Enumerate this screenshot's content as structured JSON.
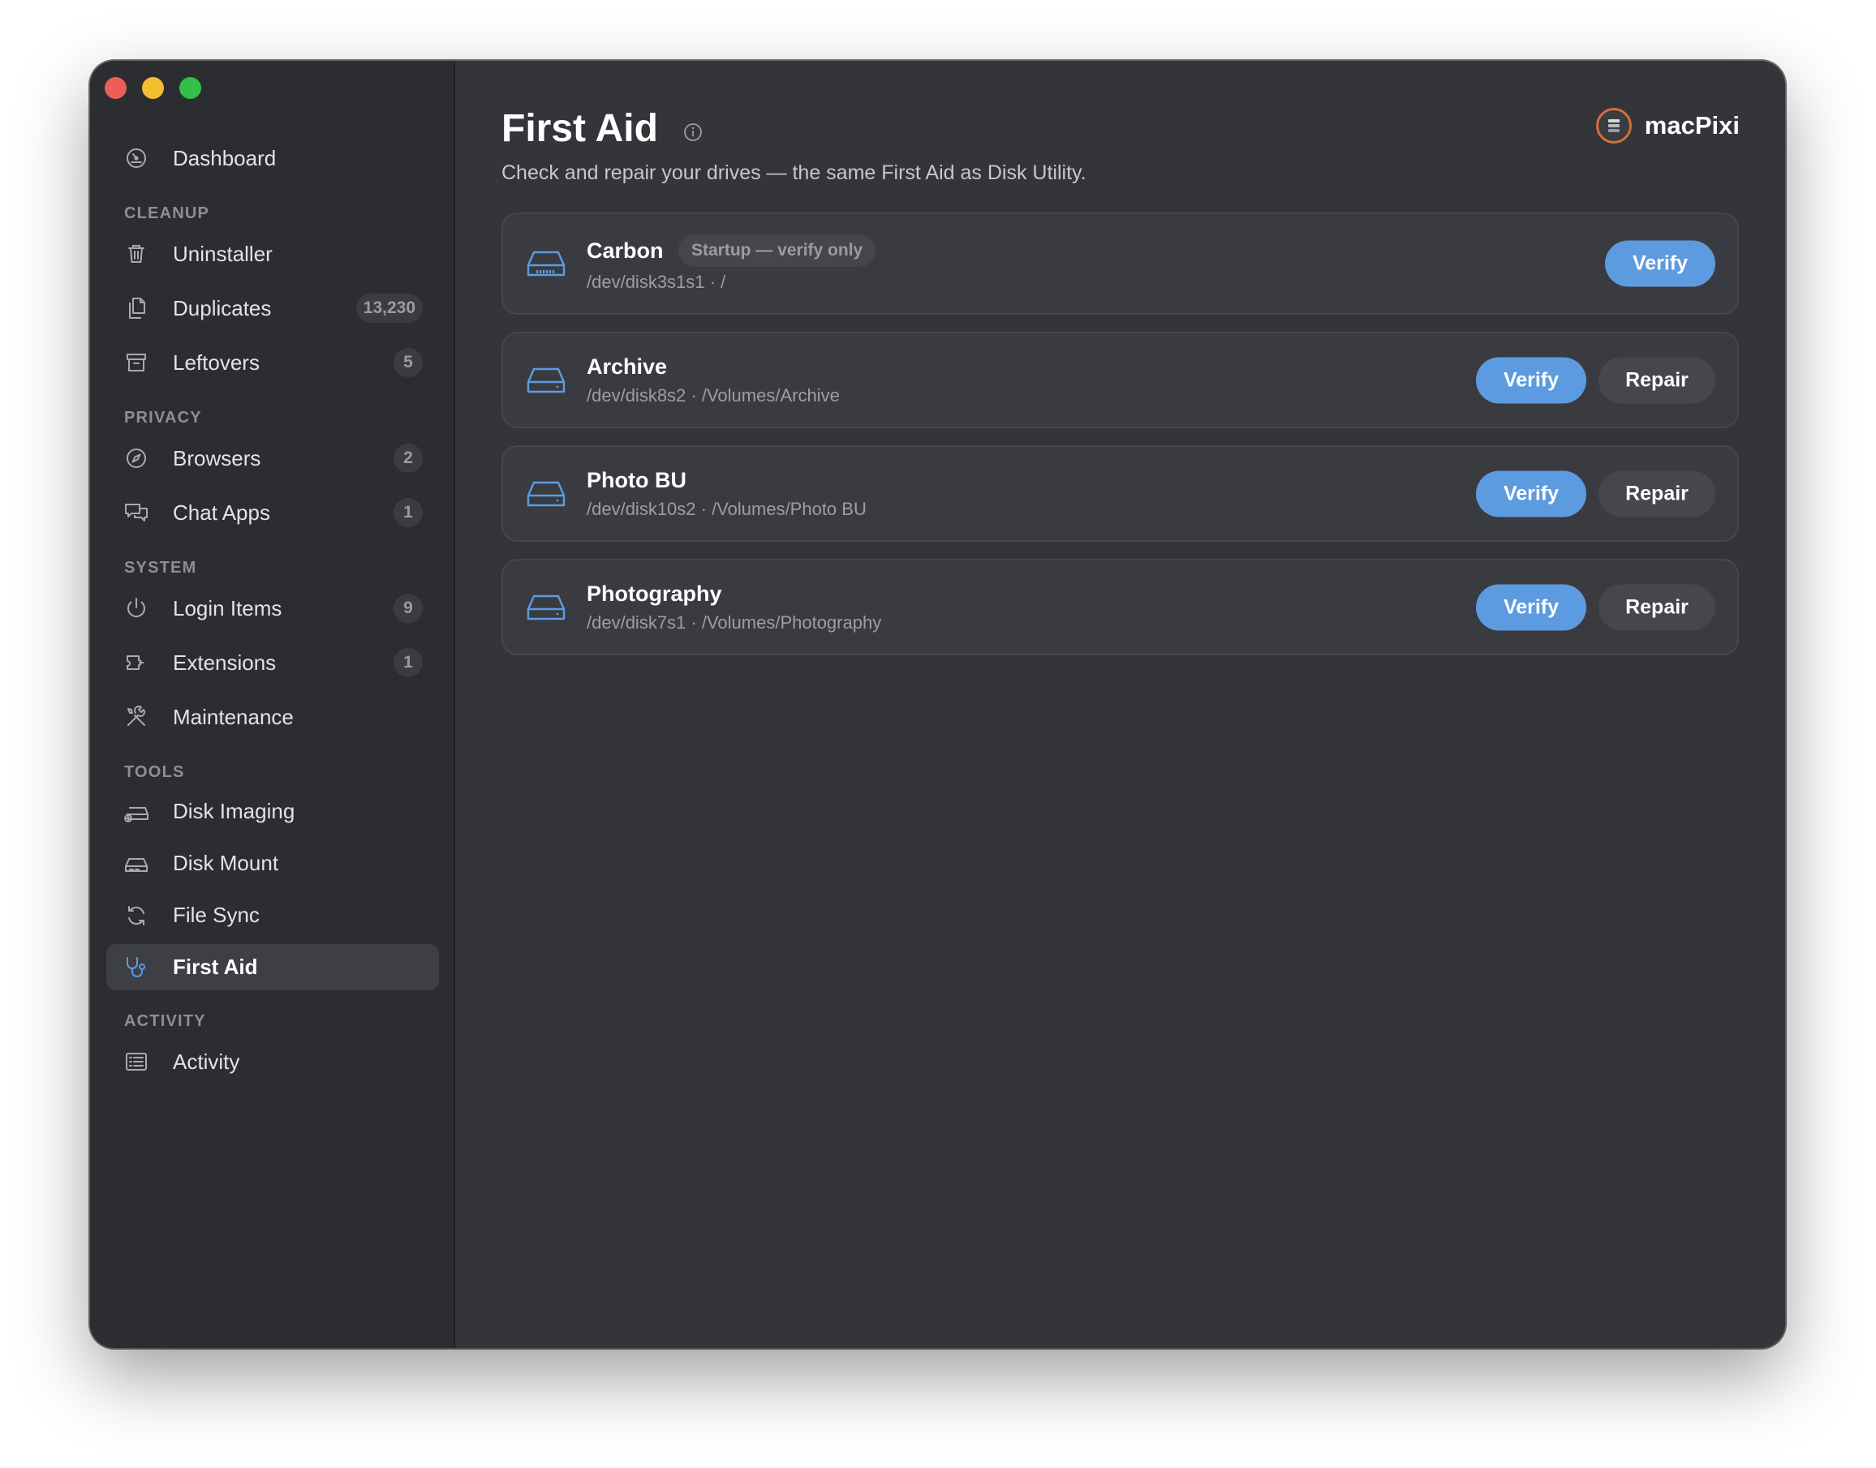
{
  "sidebar": {
    "dashboard": {
      "label": "Dashboard",
      "icon": "dashboard-icon"
    },
    "sections": {
      "cleanup": {
        "title": "CLEANUP",
        "uninstaller": {
          "label": "Uninstaller",
          "icon": "trash-icon"
        },
        "duplicates": {
          "label": "Duplicates",
          "badge": "13,230",
          "icon": "duplicate-files-icon"
        },
        "leftovers": {
          "label": "Leftovers",
          "badge": "5",
          "icon": "archive-box-icon"
        }
      },
      "privacy": {
        "title": "PRIVACY",
        "browsers": {
          "label": "Browsers",
          "badge": "2",
          "icon": "compass-icon"
        },
        "chat_apps": {
          "label": "Chat Apps",
          "badge": "1",
          "icon": "chat-bubbles-icon"
        }
      },
      "system": {
        "title": "SYSTEM",
        "login_items": {
          "label": "Login Items",
          "badge": "9",
          "icon": "power-icon"
        },
        "extensions": {
          "label": "Extensions",
          "badge": "1",
          "icon": "puzzle-icon"
        },
        "maintenance": {
          "label": "Maintenance",
          "icon": "wrench-screwdriver-icon"
        }
      },
      "tools": {
        "title": "TOOLS",
        "disk_imaging": {
          "label": "Disk Imaging",
          "icon": "disk-add-icon"
        },
        "disk_mount": {
          "label": "Disk Mount",
          "icon": "disk-mount-icon"
        },
        "file_sync": {
          "label": "File Sync",
          "icon": "sync-arrows-icon"
        },
        "first_aid": {
          "label": "First Aid",
          "icon": "stethoscope-icon",
          "active": true
        }
      },
      "activity": {
        "title": "ACTIVITY",
        "activity": {
          "label": "Activity",
          "icon": "list-icon"
        }
      }
    }
  },
  "header": {
    "title": "First Aid",
    "subtitle": "Check and repair your drives — the same First Aid as Disk Utility.",
    "brand": "macPixi"
  },
  "drives": [
    {
      "name": "Carbon",
      "tag": "Startup — verify only",
      "path": "/dev/disk3s1s1 · /",
      "verify_label": "Verify"
    },
    {
      "name": "Archive",
      "path": "/dev/disk8s2 · /Volumes/Archive",
      "verify_label": "Verify",
      "repair_label": "Repair"
    },
    {
      "name": "Photo BU",
      "path": "/dev/disk10s2 · /Volumes/Photo BU",
      "verify_label": "Verify",
      "repair_label": "Repair"
    },
    {
      "name": "Photography",
      "path": "/dev/disk7s1 · /Volumes/Photography",
      "verify_label": "Verify",
      "repair_label": "Repair"
    }
  ],
  "colors": {
    "accent": "#5d9be0",
    "window_bg": "#33353a",
    "sidebar_bg": "#2b2d31",
    "card_bg": "#393b40",
    "brand_ring": "#d0703a"
  }
}
